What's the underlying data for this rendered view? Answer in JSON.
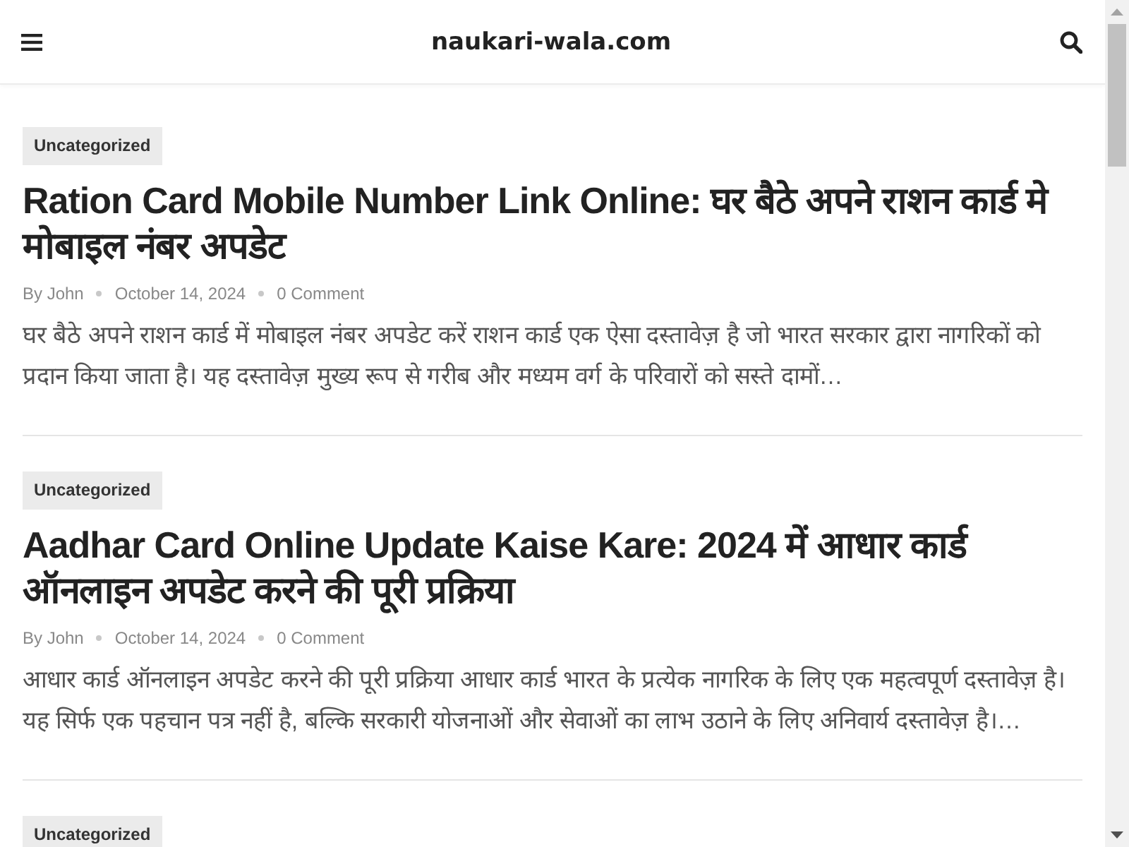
{
  "header": {
    "site_title": "naukari-wala.com"
  },
  "posts": [
    {
      "category": "Uncategorized",
      "title": "Ration Card Mobile Number Link Online: घर बैठे अपने राशन कार्ड मे मोबाइल नंबर अपडेट",
      "author": "By John",
      "date": "October 14, 2024",
      "comments": "0 Comment",
      "excerpt": "घर बैठे अपने राशन कार्ड में मोबाइल नंबर अपडेट करें राशन कार्ड एक ऐसा दस्तावेज़ है जो भारत सरकार द्वारा नागरिकों को प्रदान किया जाता है। यह दस्तावेज़ मुख्य रूप से गरीब और मध्यम वर्ग के परिवारों को सस्ते दामों…"
    },
    {
      "category": "Uncategorized",
      "title": "Aadhar Card Online Update Kaise Kare: 2024 में आधार कार्ड ऑनलाइन अपडेट करने की पूरी प्रक्रिया",
      "author": "By John",
      "date": "October 14, 2024",
      "comments": "0 Comment",
      "excerpt": "आधार कार्ड ऑनलाइन अपडेट करने की पूरी प्रक्रिया आधार कार्ड भारत के प्रत्येक नागरिक के लिए एक महत्वपूर्ण दस्तावेज़ है। यह सिर्फ एक पहचान पत्र नहीं है, बल्कि सरकारी योजनाओं और सेवाओं का लाभ उठाने के लिए अनिवार्य दस्तावेज़ है।…"
    },
    {
      "category": "Uncategorized"
    }
  ]
}
